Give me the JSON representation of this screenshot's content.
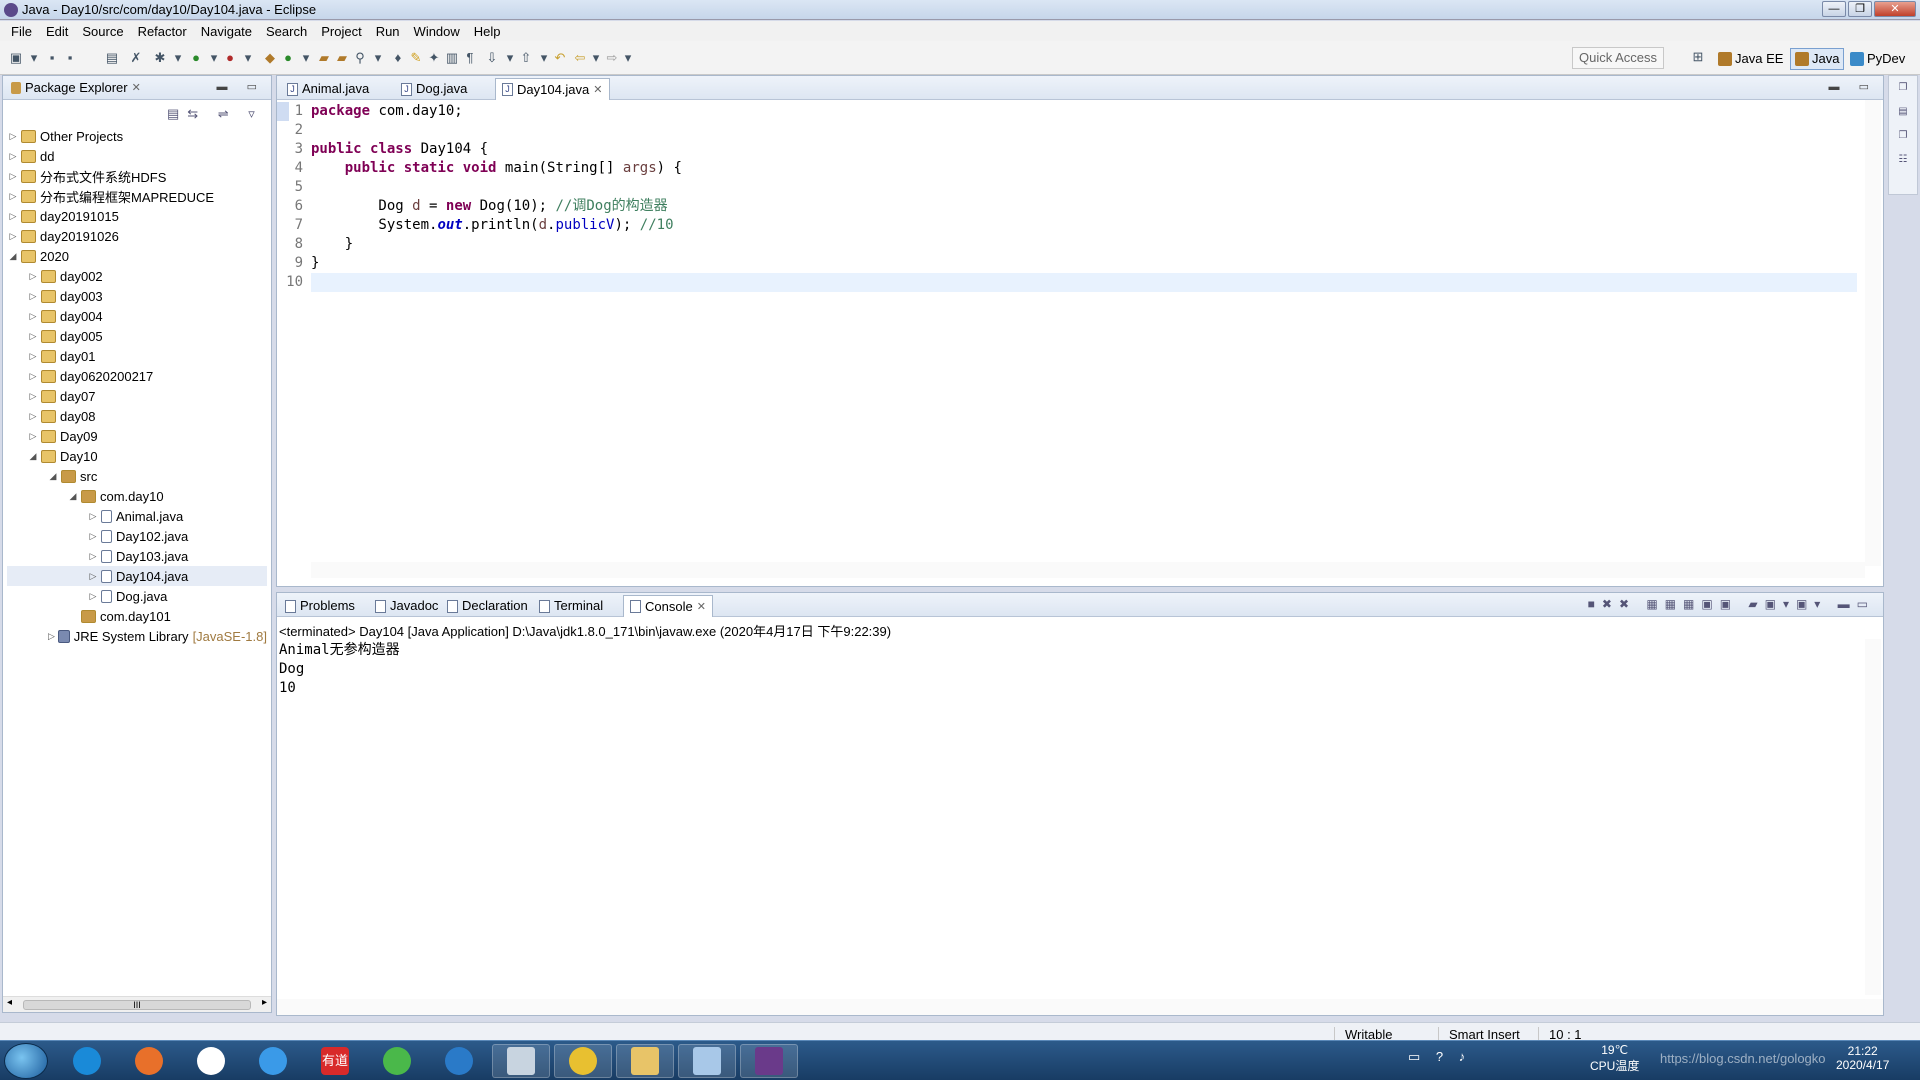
{
  "window": {
    "title": "Java - Day10/src/com/day10/Day104.java - Eclipse"
  },
  "menu": [
    "File",
    "Edit",
    "Source",
    "Refactor",
    "Navigate",
    "Search",
    "Project",
    "Run",
    "Window",
    "Help"
  ],
  "toolbar": {
    "quick_access": "Quick Access",
    "perspectives": [
      "Java EE",
      "Java",
      "PyDev"
    ]
  },
  "explorer": {
    "title": "Package Explorer",
    "tree": [
      {
        "label": "Other Projects",
        "depth": 0,
        "arrow": "▷",
        "icon": "folder"
      },
      {
        "label": "dd",
        "depth": 0,
        "arrow": "▷",
        "icon": "folder"
      },
      {
        "label": "分布式文件系统HDFS",
        "depth": 0,
        "arrow": "▷",
        "icon": "folder"
      },
      {
        "label": "分布式编程框架MAPREDUCE",
        "depth": 0,
        "arrow": "▷",
        "icon": "folder"
      },
      {
        "label": "day20191015",
        "depth": 0,
        "arrow": "▷",
        "icon": "folder"
      },
      {
        "label": "day20191026",
        "depth": 0,
        "arrow": "▷",
        "icon": "folder"
      },
      {
        "label": "2020",
        "depth": 0,
        "arrow": "◢",
        "icon": "folder"
      },
      {
        "label": "day002",
        "depth": 1,
        "arrow": "▷",
        "icon": "folder"
      },
      {
        "label": "day003",
        "depth": 1,
        "arrow": "▷",
        "icon": "folder"
      },
      {
        "label": "day004",
        "depth": 1,
        "arrow": "▷",
        "icon": "folder"
      },
      {
        "label": "day005",
        "depth": 1,
        "arrow": "▷",
        "icon": "folder"
      },
      {
        "label": "day01",
        "depth": 1,
        "arrow": "▷",
        "icon": "folder"
      },
      {
        "label": "day0620200217",
        "depth": 1,
        "arrow": "▷",
        "icon": "folder"
      },
      {
        "label": "day07",
        "depth": 1,
        "arrow": "▷",
        "icon": "folder"
      },
      {
        "label": "day08",
        "depth": 1,
        "arrow": "▷",
        "icon": "folder"
      },
      {
        "label": "Day09",
        "depth": 1,
        "arrow": "▷",
        "icon": "folder"
      },
      {
        "label": "Day10",
        "depth": 1,
        "arrow": "◢",
        "icon": "folder"
      },
      {
        "label": "src",
        "depth": 2,
        "arrow": "◢",
        "icon": "pkg"
      },
      {
        "label": "com.day10",
        "depth": 3,
        "arrow": "◢",
        "icon": "pkg"
      },
      {
        "label": "Animal.java",
        "depth": 4,
        "arrow": "▷",
        "icon": "java"
      },
      {
        "label": "Day102.java",
        "depth": 4,
        "arrow": "▷",
        "icon": "java"
      },
      {
        "label": "Day103.java",
        "depth": 4,
        "arrow": "▷",
        "icon": "java"
      },
      {
        "label": "Day104.java",
        "depth": 4,
        "arrow": "▷",
        "icon": "java",
        "selected": true
      },
      {
        "label": "Dog.java",
        "depth": 4,
        "arrow": "▷",
        "icon": "java"
      },
      {
        "label": "com.day101",
        "depth": 3,
        "arrow": "",
        "icon": "pkg"
      },
      {
        "label": "JRE System Library",
        "suffix": "[JavaSE-1.8]",
        "depth": 2,
        "arrow": "▷",
        "icon": "lib"
      }
    ],
    "scroll_marker": "III"
  },
  "editor": {
    "tabs": [
      "Animal.java",
      "Dog.java",
      "Day104.java"
    ],
    "active_tab": 2,
    "line_numbers": [
      "1",
      "2",
      "3",
      "4",
      "5",
      "6",
      "7",
      "8",
      "9",
      "10"
    ],
    "lines": [
      [
        {
          "t": "package",
          "c": "kw"
        },
        {
          "t": " com.day10;",
          "c": ""
        }
      ],
      [],
      [
        {
          "t": "public",
          "c": "kw"
        },
        {
          "t": " ",
          "c": ""
        },
        {
          "t": "class",
          "c": "kw"
        },
        {
          "t": " Day104 {",
          "c": ""
        }
      ],
      [
        {
          "t": "    ",
          "c": ""
        },
        {
          "t": "public",
          "c": "kw"
        },
        {
          "t": " ",
          "c": ""
        },
        {
          "t": "static",
          "c": "kw"
        },
        {
          "t": " ",
          "c": ""
        },
        {
          "t": "void",
          "c": "kw"
        },
        {
          "t": " main(String[] ",
          "c": ""
        },
        {
          "t": "args",
          "c": "var"
        },
        {
          "t": ") {",
          "c": ""
        }
      ],
      [],
      [
        {
          "t": "        Dog ",
          "c": ""
        },
        {
          "t": "d",
          "c": "var"
        },
        {
          "t": " = ",
          "c": ""
        },
        {
          "t": "new",
          "c": "kw"
        },
        {
          "t": " Dog(10); ",
          "c": ""
        },
        {
          "t": "//调Dog的构造器",
          "c": "cm"
        }
      ],
      [
        {
          "t": "        System.",
          "c": ""
        },
        {
          "t": "out",
          "c": "sti"
        },
        {
          "t": ".println(",
          "c": ""
        },
        {
          "t": "d",
          "c": "var"
        },
        {
          "t": ".",
          "c": ""
        },
        {
          "t": "publicV",
          "c": "fld"
        },
        {
          "t": "); ",
          "c": ""
        },
        {
          "t": "//10",
          "c": "cm"
        }
      ],
      [
        {
          "t": "    }",
          "c": ""
        }
      ],
      [
        {
          "t": "}",
          "c": ""
        }
      ],
      []
    ]
  },
  "bottom": {
    "tabs": [
      "Problems",
      "Javadoc",
      "Declaration",
      "Terminal",
      "Console"
    ],
    "active_tab": 4,
    "header": "<terminated> Day104 [Java Application] D:\\Java\\jdk1.8.0_171\\bin\\javaw.exe (2020年4月17日 下午9:22:39)",
    "output": [
      "Animal无参构造器",
      "Dog",
      "10"
    ]
  },
  "status": {
    "mode1": "Writable",
    "mode2": "Smart Insert",
    "position": "10 : 1"
  },
  "taskbar": {
    "apps": [
      "ie",
      "firefox",
      "baidu-netdisk",
      "onedrive",
      "youdao",
      "360",
      "ie2",
      "calculator",
      "chrome",
      "explorer",
      "notepad",
      "eclipse"
    ],
    "youdao_label": "有道",
    "temp": "19℃",
    "cpu_label": "CPU温度",
    "time": "21:22",
    "date": "2020/4/17",
    "watermark": "https://blog.csdn.net/gologko"
  }
}
